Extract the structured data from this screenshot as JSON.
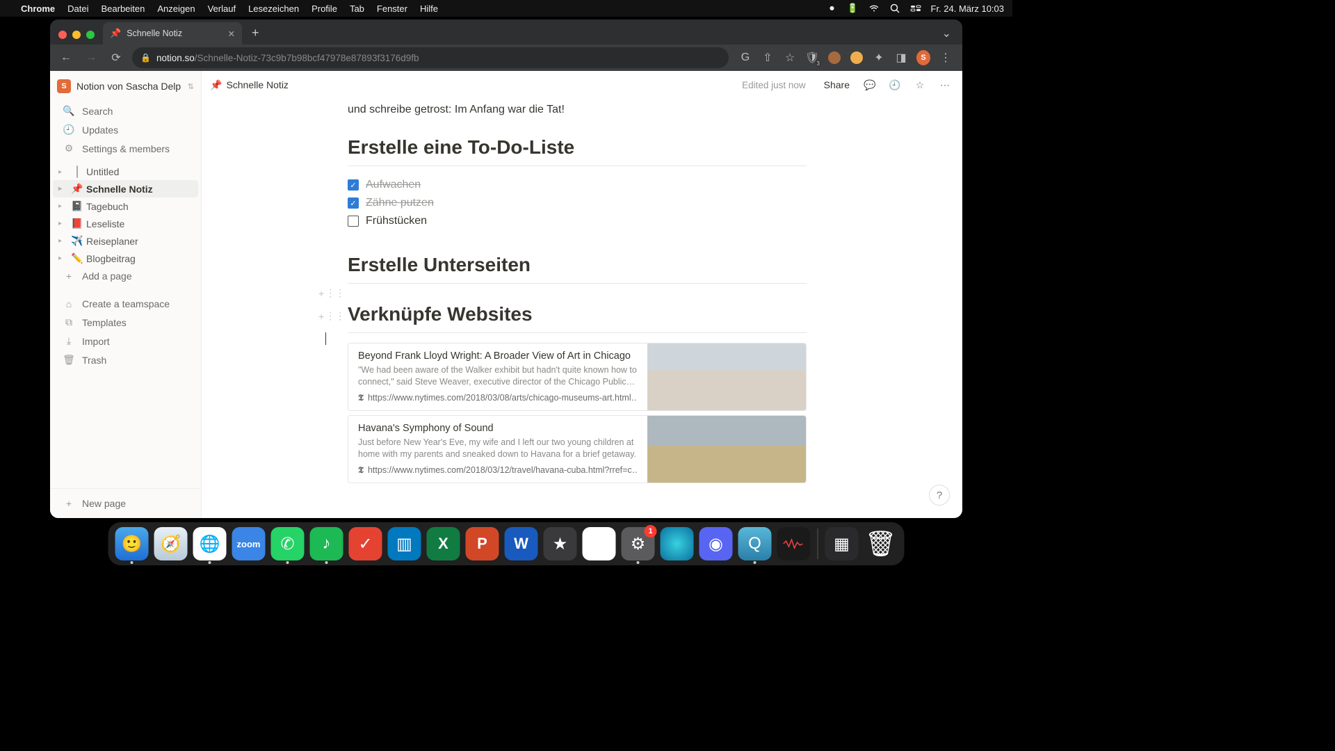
{
  "menubar": {
    "app": "Chrome",
    "items": [
      "Datei",
      "Bearbeiten",
      "Anzeigen",
      "Verlauf",
      "Lesezeichen",
      "Profile",
      "Tab",
      "Fenster",
      "Hilfe"
    ],
    "clock": "Fr. 24. März  10:03"
  },
  "browser": {
    "tab_title": "Schnelle Notiz",
    "tab_icon": "📌",
    "url_domain": "notion.so",
    "url_path": "/Schnelle-Notiz-73c9b7b98bcf47978e87893f3176d9fb",
    "avatar_initial": "S"
  },
  "notion": {
    "workspace": "Notion von Sascha Delp",
    "workspace_initial": "S",
    "side_core": [
      {
        "icon": "🔍",
        "label": "Search"
      },
      {
        "icon": "🕘",
        "label": "Updates"
      },
      {
        "icon": "⚙",
        "label": "Settings & members"
      }
    ],
    "pages": [
      {
        "emoji": "",
        "label": "Untitled",
        "plain": true
      },
      {
        "emoji": "📌",
        "label": "Schnelle Notiz",
        "active": true
      },
      {
        "emoji": "📓",
        "label": "Tagebuch"
      },
      {
        "emoji": "📕",
        "label": "Leseliste"
      },
      {
        "emoji": "✈️",
        "label": "Reiseplaner"
      },
      {
        "emoji": "✏️",
        "label": "Blogbeitrag"
      }
    ],
    "add_page": "Add a page",
    "side_tools": [
      {
        "icon": "👥",
        "label": "Create a teamspace"
      },
      {
        "icon": "⧉",
        "label": "Templates"
      },
      {
        "icon": "⤓",
        "label": "Import"
      },
      {
        "icon": "🗑",
        "label": "Trash"
      }
    ],
    "new_page": "New page",
    "breadcrumb_icon": "📌",
    "breadcrumb": "Schnelle Notiz",
    "edited": "Edited just now",
    "share": "Share"
  },
  "content": {
    "intro_line": "und schreibe getrost: Im Anfang war die Tat!",
    "h_todo": "Erstelle eine To-Do-Liste",
    "todos": [
      {
        "label": "Aufwachen",
        "done": true
      },
      {
        "label": "Zähne putzen",
        "done": true
      },
      {
        "label": "Frühstücken",
        "done": false
      }
    ],
    "h_sub": "Erstelle Unterseiten",
    "h_links": "Verknüpfe Websites",
    "bookmarks": [
      {
        "title": "Beyond Frank Lloyd Wright: A Broader View of Art in Chicago",
        "desc": "\"We had been aware of the Walker exhibit but hadn't quite known how to connect,\" said Steve Weaver, executive director of the Chicago Public Art",
        "url": "https://www.nytimes.com/2018/03/08/arts/chicago-museums-art.html…",
        "img": "chicago"
      },
      {
        "title": "Havana's Symphony of Sound",
        "desc": "Just before New Year's Eve, my wife and I left our two young children at home with my parents and sneaked down to Havana for a brief getaway.",
        "url": "https://www.nytimes.com/2018/03/12/travel/havana-cuba.html?rref=c…",
        "img": "havana"
      }
    ]
  },
  "dock": {
    "settings_badge": "1"
  }
}
